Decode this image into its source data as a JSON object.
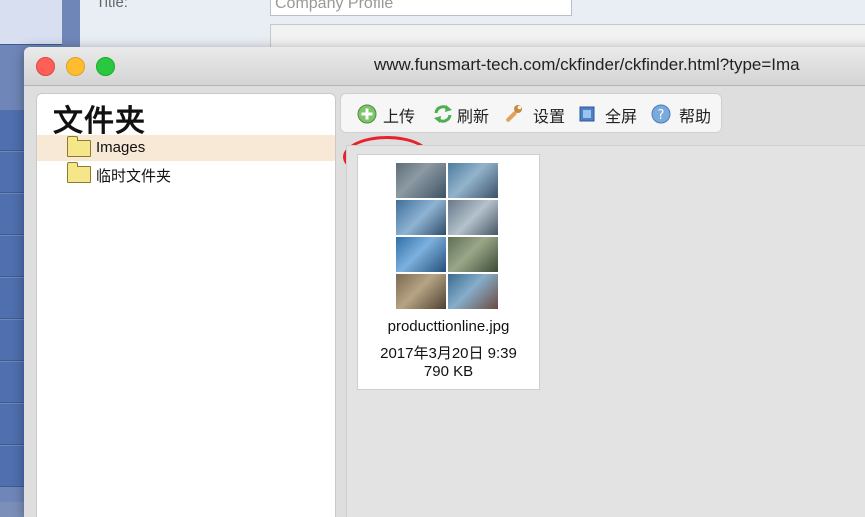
{
  "background": {
    "title_label": "Title:",
    "title_value": "Company Profile"
  },
  "window": {
    "url": "www.funsmart-tech.com/ckfinder/ckfinder.html?type=Ima"
  },
  "folders": {
    "title": "文件夹",
    "items": [
      {
        "label": "Images",
        "selected": true
      },
      {
        "label": "临时文件夹",
        "selected": false
      }
    ]
  },
  "toolbar": {
    "upload_label": "上传",
    "refresh_label": "刷新",
    "settings_label": "设置",
    "fullscreen_label": "全屏",
    "help_label": "帮助",
    "highlight_color": "#e8222c"
  },
  "files": [
    {
      "name": "producttionline.jpg",
      "date": "2017年3月20日 9:39",
      "size": "790 KB"
    }
  ],
  "icons": {
    "upload": "plus-circle-icon",
    "refresh": "refresh-icon",
    "settings": "wrench-icon",
    "fullscreen": "fullscreen-icon",
    "help": "help-icon",
    "folder": "folder-icon"
  }
}
